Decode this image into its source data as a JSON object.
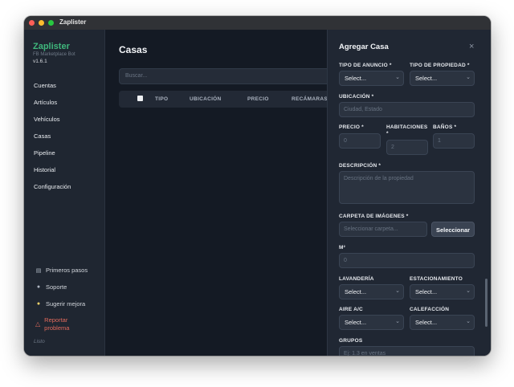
{
  "window": {
    "title": "Zaplister"
  },
  "sidebar": {
    "brand": "Zaplister",
    "subtitle": "FB Marketplace Bot",
    "version": "v1.6.1",
    "nav": [
      "Cuentas",
      "Artículos",
      "Vehículos",
      "Casas",
      "Pipeline",
      "Historial",
      "Configuración"
    ],
    "footer": {
      "getting_started": "Primeros pasos",
      "support": "Soporte",
      "suggest": "Sugerir mejora",
      "report_line1": "Reportar",
      "report_line2": "problema",
      "status": "Listo"
    }
  },
  "main": {
    "title": "Casas",
    "search_placeholder": "Buscar...",
    "columns": [
      "TIPO",
      "UBICACIÓN",
      "PRECIO",
      "RECÁMARAS/"
    ]
  },
  "panel": {
    "title": "Agregar Casa",
    "close": "×",
    "tipo_anuncio": {
      "label": "TIPO DE ANUNCIO *",
      "value": "Select..."
    },
    "tipo_propiedad": {
      "label": "TIPO DE PROPIEDAD *",
      "value": "Select..."
    },
    "ubicacion": {
      "label": "UBICACIÓN *",
      "placeholder": "Ciudad, Estado"
    },
    "precio": {
      "label": "PRECIO *",
      "placeholder": "0"
    },
    "habitaciones": {
      "label_line1": "HABITACIONES",
      "label_line2": "*",
      "placeholder": "2"
    },
    "banos": {
      "label": "BAÑOS *",
      "placeholder": "1"
    },
    "descripcion": {
      "label": "DESCRIPCIÓN *",
      "placeholder": "Descripción de la propiedad"
    },
    "carpeta": {
      "label": "CARPETA DE IMÁGENES *",
      "placeholder": "Seleccionar carpeta...",
      "button": "Seleccionar"
    },
    "m2": {
      "label": "M²",
      "placeholder": "0"
    },
    "lavanderia": {
      "label": "LAVANDERÍA",
      "value": "Select..."
    },
    "estacionamiento": {
      "label": "ESTACIONAMIENTO",
      "value": "Select..."
    },
    "aire": {
      "label": "AIRE A/C",
      "value": "Select..."
    },
    "calefaccion": {
      "label": "CALEFACCIÓN",
      "value": "Select..."
    },
    "grupos": {
      "label": "GRUPOS",
      "placeholder": "Ej: 1.3 en ventas"
    }
  },
  "colors": {
    "accent": "#3fb77c",
    "danger": "#e26a5c",
    "background": "#141a24"
  }
}
